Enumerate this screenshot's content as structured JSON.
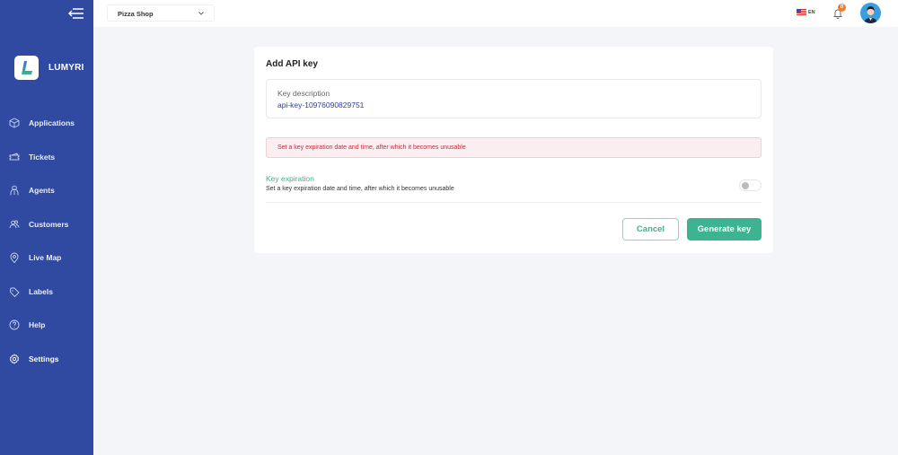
{
  "sidebar": {
    "brand": "LUMYRI",
    "items": [
      {
        "label": "Applications",
        "icon": "box-icon"
      },
      {
        "label": "Tickets",
        "icon": "ticket-icon"
      },
      {
        "label": "Agents",
        "icon": "agent-icon"
      },
      {
        "label": "Customers",
        "icon": "users-icon"
      },
      {
        "label": "Live Map",
        "icon": "map-pin-icon"
      },
      {
        "label": "Labels",
        "icon": "tag-icon"
      },
      {
        "label": "Help",
        "icon": "help-icon"
      },
      {
        "label": "Settings",
        "icon": "gear-icon"
      }
    ]
  },
  "topbar": {
    "shop": "Pizza Shop",
    "language": "EN",
    "notifications_count": "0"
  },
  "card": {
    "title": "Add API key",
    "description_label": "Key description",
    "description_value": "api-key-10976090829751",
    "alert": "Set a key expiration date and time, after which it becomes unusable",
    "expiration_title": "Key expiration",
    "expiration_desc": "Set a key expiration date and time, after which it becomes unusable",
    "expiration_enabled": false,
    "cancel_label": "Cancel",
    "generate_label": "Generate key"
  },
  "colors": {
    "sidebar": "#2f4aa0",
    "accent": "#3db392",
    "alert": "#c8283c"
  }
}
